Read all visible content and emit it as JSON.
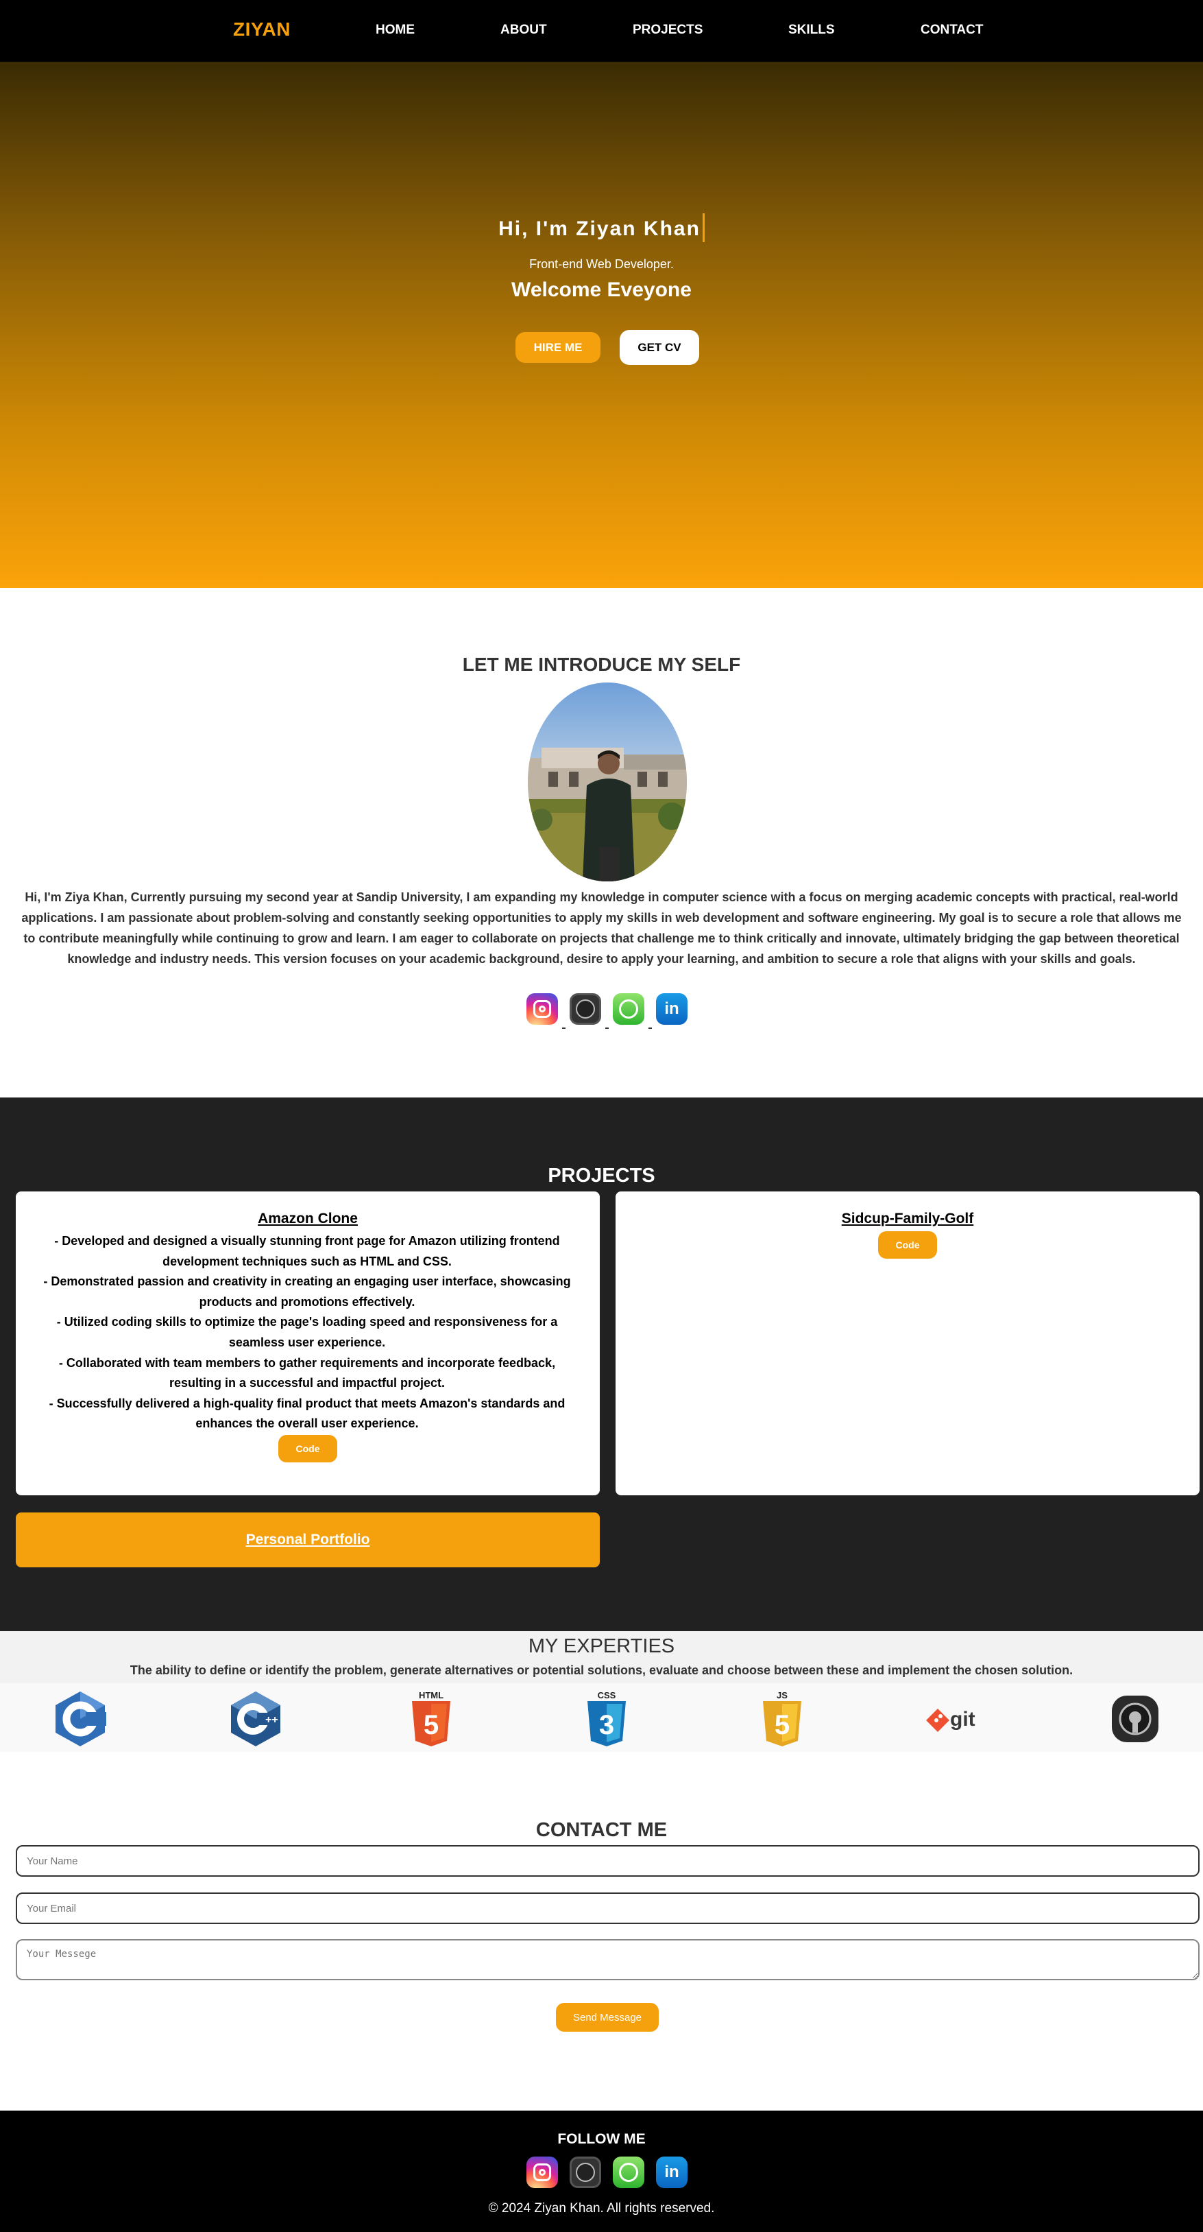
{
  "nav": {
    "brand": "ZIYAN",
    "links": [
      "HOME",
      "ABOUT",
      "PROJECTS",
      "SKILLS",
      "CONTACT"
    ]
  },
  "hero": {
    "greeting": "Hi, I'm Ziyan Khan",
    "subtitle": "Front-end Web Developer.",
    "welcome": "Welcome Eveyone",
    "hire_label": "HIRE ME",
    "cv_label": "GET CV"
  },
  "about": {
    "title": "LET ME INTRODUCE MY SELF",
    "text": "Hi, I'm Ziya Khan, Currently pursuing my second year at Sandip University, I am expanding my knowledge in computer science with a focus on merging academic concepts with practical, real-world applications. I am passionate about problem-solving and constantly seeking opportunities to apply my skills in web development and software engineering. My goal is to secure a role that allows me to contribute meaningfully while continuing to grow and learn. I am eager to collaborate on projects that challenge me to think critically and innovate, ultimately bridging the gap between theoretical knowledge and industry needs. This version focuses on your academic background, desire to apply your learning, and ambition to secure a role that aligns with your skills and goals.",
    "social_icons": [
      "instagram-icon",
      "github-icon",
      "whatsapp-icon",
      "linkedin-icon"
    ]
  },
  "projects": {
    "title": "PROJECTS",
    "items": [
      {
        "title": "Amazon Clone",
        "bullets": [
          "- Developed and designed a visually stunning front page for Amazon utilizing frontend development techniques such as HTML and CSS.",
          "- Demonstrated passion and creativity in creating an engaging user interface, showcasing products and promotions effectively.",
          "- Utilized coding skills to optimize the page's loading speed and responsiveness for a seamless user experience.",
          "- Collaborated with team members to gather requirements and incorporate feedback, resulting in a successful and impactful project.",
          "- Successfully delivered a high-quality final product that meets Amazon's standards and enhances the overall user experience."
        ],
        "code_label": "Code"
      },
      {
        "title": "Sidcup-Family-Golf",
        "code_label": "Code"
      }
    ],
    "portfolio_label": "Personal Portfolio"
  },
  "experties": {
    "title": "MY EXPERTIES",
    "description": "The ability to define or identify the problem, generate alternatives or potential solutions, evaluate and choose between these and implement the chosen solution.",
    "skills": [
      "c-icon",
      "cpp-icon",
      "html5-icon",
      "css3-icon",
      "js-icon",
      "git-icon",
      "github-icon"
    ],
    "skill_text": {
      "c": "C",
      "cpp": "C++",
      "html": "HTML",
      "html_num": "5",
      "css": "CSS",
      "css_num": "3",
      "js": "JS",
      "js_num": "5",
      "git": "git"
    }
  },
  "contact": {
    "title": "CONTACT ME",
    "name_placeholder": "Your Name",
    "email_placeholder": "Your Email",
    "message_placeholder": "Your Messege",
    "send_label": "Send Message"
  },
  "footer": {
    "follow": "FOLLOW ME",
    "copyright": "© 2024 Ziyan Khan. All rights reserved."
  },
  "colors": {
    "accent": "#f5a00d",
    "nav_bg": "#000000",
    "projects_bg": "#212121"
  }
}
